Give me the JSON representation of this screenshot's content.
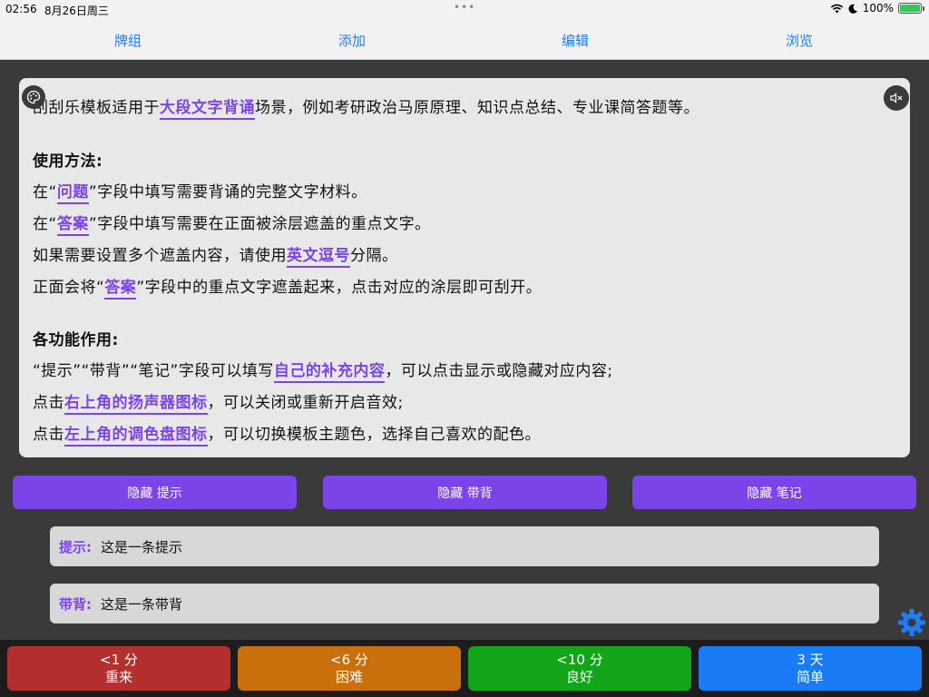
{
  "status": {
    "time": "02:56",
    "date": "8月26日周三",
    "battery": "100%"
  },
  "nav": {
    "deck": "牌组",
    "add": "添加",
    "edit": "编辑",
    "browse": "浏览"
  },
  "content": {
    "intro_pre": "刮刮乐模板适用于",
    "intro_hl": "大段文字背诵",
    "intro_post": "场景，例如考研政治马原原理、知识点总结、专业课简答题等。",
    "usage_title": "使用方法:",
    "usage1_pre": "在“",
    "usage1_hl": "问题",
    "usage1_post": "”字段中填写需要背诵的完整文字材料。",
    "usage2_pre": "在“",
    "usage2_hl": "答案",
    "usage2_post": "”字段中填写需要在正面被涂层遮盖的重点文字。",
    "usage3_pre": "如果需要设置多个遮盖内容，请使用",
    "usage3_hl": "英文逗号",
    "usage3_post": "分隔。",
    "usage4_pre": "正面会将“",
    "usage4_hl": "答案",
    "usage4_post": "”字段中的重点文字遮盖起来，点击对应的涂层即可刮开。",
    "func_title": "各功能作用:",
    "func1_pre": "“提示”“带背”“笔记”字段可以填写",
    "func1_hl": "自己的补充内容",
    "func1_post": "，可以点击显示或隐藏对应内容;",
    "func2_pre": "点击",
    "func2_hl": "右上角的扬声器图标",
    "func2_post": "，可以关闭或重新开启音效;",
    "func3_pre": "点击",
    "func3_hl": "左上角的调色盘图标",
    "func3_post": "，可以切换模板主题色，选择自己喜欢的配色。"
  },
  "toggles": {
    "hint": "隐藏 提示",
    "recite": "隐藏 带背",
    "note": "隐藏 笔记"
  },
  "extras": {
    "hint_label": "提示:",
    "hint_text": "这是一条提示",
    "recite_label": "带背:",
    "recite_text": "这是一条带背"
  },
  "answers": [
    {
      "time": "<1 分",
      "label": "重来",
      "color": "#b3302f"
    },
    {
      "time": "<6 分",
      "label": "困难",
      "color": "#c9700c"
    },
    {
      "time": "<10 分",
      "label": "良好",
      "color": "#12a51a"
    },
    {
      "time": "3 天",
      "label": "简单",
      "color": "#1a7cf5"
    }
  ],
  "colors": {
    "accent": "#7b44e8",
    "nav_text": "#1f7cf5"
  },
  "icons": {
    "palette": "palette-icon",
    "speaker": "speaker-muted-icon",
    "gear": "gear-icon"
  }
}
